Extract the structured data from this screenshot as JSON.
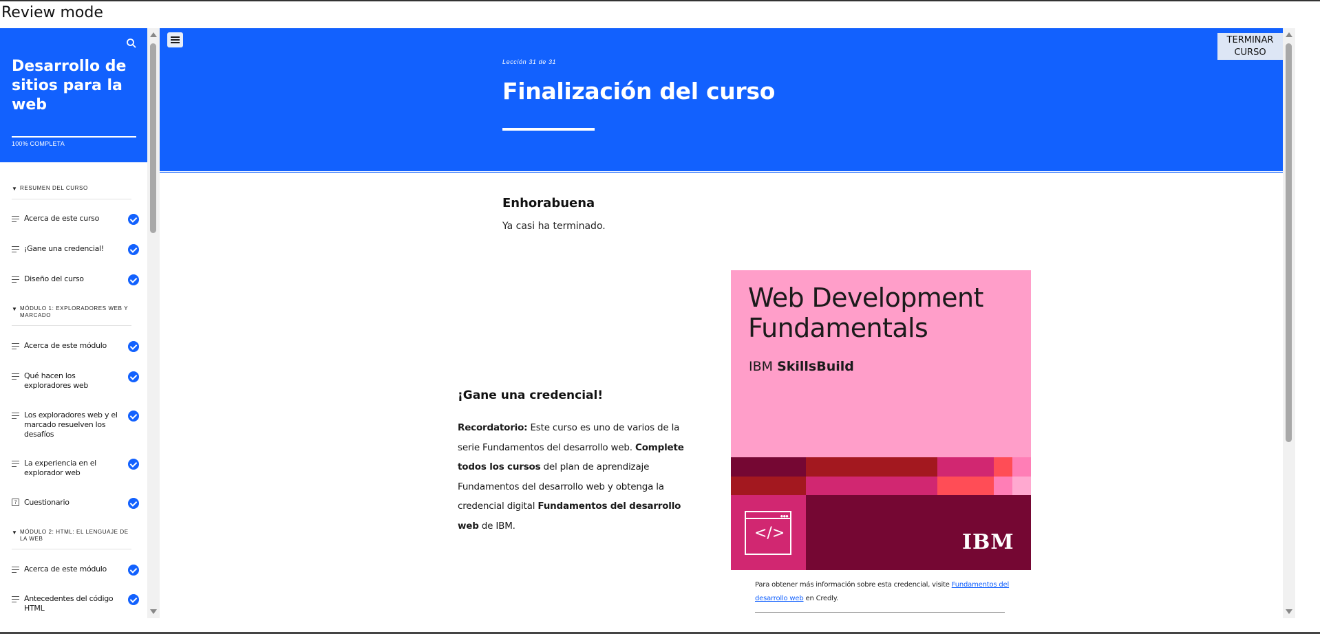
{
  "window": {
    "title": "Review mode"
  },
  "sidebar": {
    "course_title": "Desarrollo de sitios para la web",
    "progress_text": "100% COMPLETA",
    "progress": 1.0,
    "sections": [
      {
        "label": "RESUMEN DEL CURSO"
      },
      {
        "label": "MÓDULO 1: EXPLORADORES WEB Y MARCADO"
      },
      {
        "label": "MÓDULO 2: HTML: EL LENGUAJE DE LA WEB"
      }
    ],
    "items": [
      {
        "label": "Acerca de este curso",
        "type": "lesson",
        "complete": true
      },
      {
        "label": "¡Gane una credencial!",
        "type": "lesson",
        "complete": true
      },
      {
        "label": "Diseño del curso",
        "type": "lesson",
        "complete": true
      },
      {
        "label": "Acerca de este módulo",
        "type": "lesson",
        "complete": true
      },
      {
        "label": "Qué hacen los exploradores web",
        "type": "lesson",
        "complete": true
      },
      {
        "label": "Los exploradores web y el marcado resuelven los desafíos",
        "type": "lesson",
        "complete": true
      },
      {
        "label": "La experiencia en el explorador web",
        "type": "lesson",
        "complete": true
      },
      {
        "label": "Cuestionario",
        "type": "quiz",
        "complete": true
      },
      {
        "label": "Acerca de este módulo",
        "type": "lesson",
        "complete": true
      },
      {
        "label": "Antecedentes del código HTML",
        "type": "lesson",
        "complete": true
      }
    ]
  },
  "header": {
    "lesson_number": "Lección 31 de 31",
    "lesson_title": "Finalización del curso",
    "finish_button": "TERMINAR CURSO"
  },
  "content": {
    "congrats_title": "Enhorabuena",
    "congrats_text": "Ya casi ha terminado.",
    "credential_title": "¡Gane una credencial!",
    "credential_parts": {
      "p1_bold": "Recordatorio:",
      "p2": " Este curso es uno de varios de la serie Fundamentos del desarrollo web. ",
      "p3_bold": "Complete todos los cursos",
      "p4": " del plan de aprendizaje Fundamentos del desarrollo web y obtenga la credencial digital ",
      "p5_bold": "Fundamentos del desarrollo web",
      "p6": " de IBM."
    },
    "badge": {
      "title": "Web Development Fundamentals",
      "brand_prefix": "IBM ",
      "brand_bold": "SkillsBuild",
      "icon_code": "</>",
      "logo": "IBM",
      "colors": {
        "background": "#ff9ec9",
        "dark": "#750733",
        "red": "#a3181f",
        "magenta": "#d12771",
        "coral": "#ff4d56",
        "pink_mid": "#ff7eb6",
        "pink_light": "#ffa9d0"
      }
    },
    "caption": {
      "before": "Para obtener más información sobre esta credencial, visite ",
      "link": "Fundamentos del desarrollo web",
      "after": " en Credly."
    }
  },
  "colors": {
    "accent": "#1261fe",
    "check": "#1261fe"
  }
}
